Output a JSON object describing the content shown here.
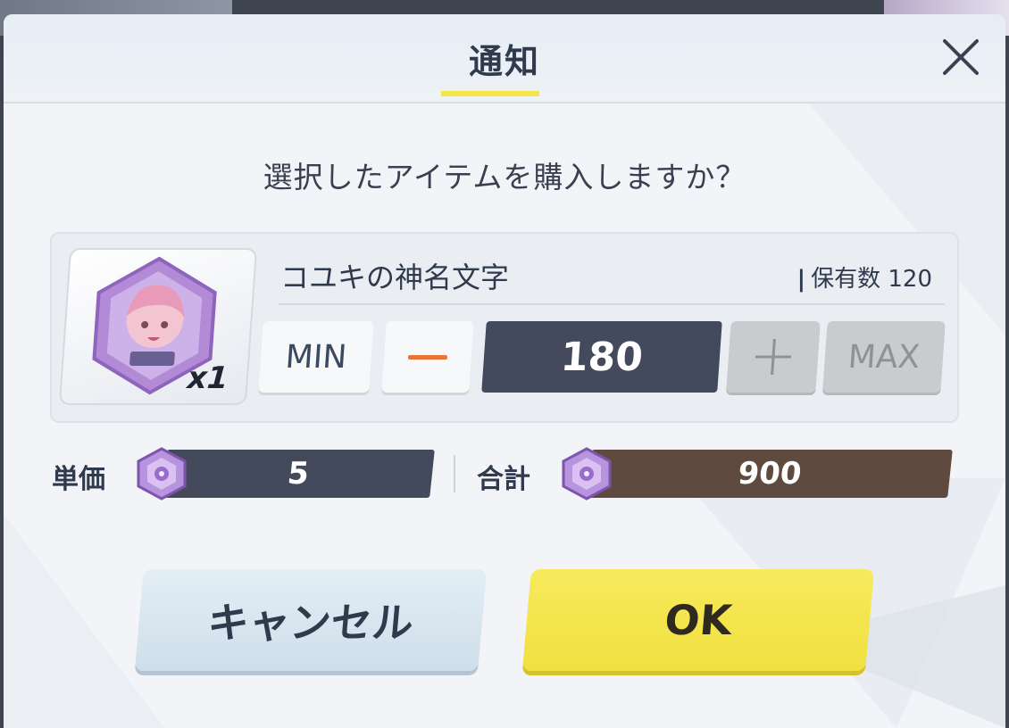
{
  "dialog": {
    "title": "通知",
    "close_icon": "close-icon",
    "question": "選択したアイテムを購入しますか？"
  },
  "item": {
    "name": "コユキの神名文字",
    "owned_label": "保有数",
    "owned_count": "120",
    "count_badge": "x1"
  },
  "quantity": {
    "min_label": "MIN",
    "minus_icon": "minus-icon",
    "value": "180",
    "plus_icon": "plus-icon",
    "max_label": "MAX"
  },
  "price": {
    "unit_label": "単価",
    "unit_value": "5",
    "total_label": "合計",
    "total_value": "900",
    "currency_icon": "gem-icon"
  },
  "buttons": {
    "cancel_label": "キャンセル",
    "ok_label": "OK"
  },
  "colors": {
    "accent_yellow": "#f4e547",
    "dark_slate": "#434a5c",
    "total_brown": "#5e4a3e",
    "minus_orange": "#e8743a"
  }
}
